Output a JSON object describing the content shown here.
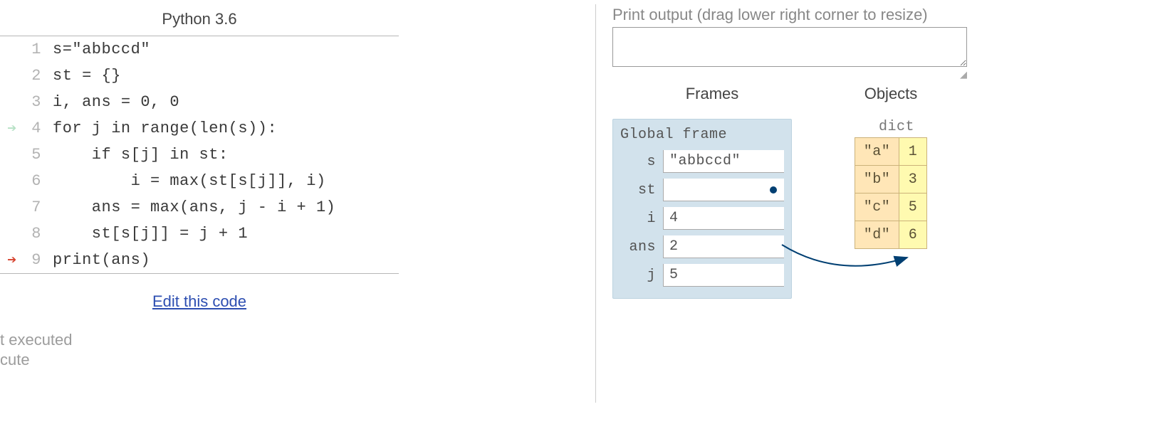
{
  "code_title": "Python 3.6",
  "code_lines": [
    {
      "n": "1",
      "arrow": "",
      "arrow_class": "",
      "text": "s=\"abbccd\""
    },
    {
      "n": "2",
      "arrow": "",
      "arrow_class": "",
      "text": "st = {}"
    },
    {
      "n": "3",
      "arrow": "",
      "arrow_class": "",
      "text": "i, ans = 0, 0"
    },
    {
      "n": "4",
      "arrow": "➔",
      "arrow_class": "arrow-green",
      "text": "for j in range(len(s)):"
    },
    {
      "n": "5",
      "arrow": "",
      "arrow_class": "",
      "text": "    if s[j] in st:"
    },
    {
      "n": "6",
      "arrow": "",
      "arrow_class": "",
      "text": "        i = max(st[s[j]], i)"
    },
    {
      "n": "7",
      "arrow": "",
      "arrow_class": "",
      "text": "    ans = max(ans, j - i + 1)"
    },
    {
      "n": "8",
      "arrow": "",
      "arrow_class": "",
      "text": "    st[s[j]] = j + 1"
    },
    {
      "n": "9",
      "arrow": "➔",
      "arrow_class": "arrow-red",
      "text": "print(ans)"
    }
  ],
  "edit_link_text": "Edit this code",
  "status_line1": "t executed",
  "status_line2": "cute",
  "print_label": "Print output (drag lower right corner to resize)",
  "print_output": "",
  "frames_header": "Frames",
  "objects_header": "Objects",
  "global_frame_label": "Global frame",
  "frame_vars": [
    {
      "name": "s",
      "value": "\"abbccd\"",
      "pointer": false
    },
    {
      "name": "st",
      "value": "",
      "pointer": true
    },
    {
      "name": "i",
      "value": "4",
      "pointer": false
    },
    {
      "name": "ans",
      "value": "2",
      "pointer": false
    },
    {
      "name": "j",
      "value": "5",
      "pointer": false
    }
  ],
  "object_type_label": "dict",
  "dict_entries": [
    {
      "k": "\"a\"",
      "v": "1"
    },
    {
      "k": "\"b\"",
      "v": "3"
    },
    {
      "k": "\"c\"",
      "v": "5"
    },
    {
      "k": "\"d\"",
      "v": "6"
    }
  ]
}
